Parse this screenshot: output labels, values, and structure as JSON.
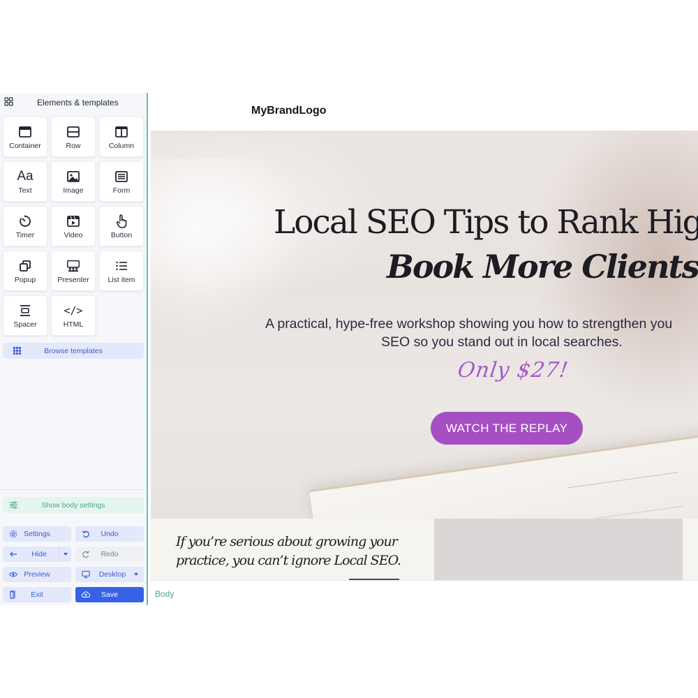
{
  "sidebar": {
    "title": "Elements & templates",
    "elements": [
      {
        "label": "Container",
        "icon": "container-icon"
      },
      {
        "label": "Row",
        "icon": "row-icon"
      },
      {
        "label": "Column",
        "icon": "column-icon"
      },
      {
        "label": "Text",
        "icon": "text-icon"
      },
      {
        "label": "Image",
        "icon": "image-icon"
      },
      {
        "label": "Form",
        "icon": "form-icon"
      },
      {
        "label": "Timer",
        "icon": "timer-icon"
      },
      {
        "label": "Video",
        "icon": "video-icon"
      },
      {
        "label": "Button",
        "icon": "pointer-icon"
      },
      {
        "label": "Popup",
        "icon": "popup-icon"
      },
      {
        "label": "Presenter",
        "icon": "presenter-icon"
      },
      {
        "label": "List item",
        "icon": "list-icon"
      },
      {
        "label": "Spacer",
        "icon": "spacer-icon"
      },
      {
        "label": "HTML",
        "icon": "code-icon"
      }
    ],
    "text_glyph": "Aa",
    "code_glyph": "</>",
    "browse_templates": "Browse templates",
    "show_body_settings": "Show body settings",
    "controls": {
      "settings": "Settings",
      "undo": "Undo",
      "hide": "Hide",
      "redo": "Redo",
      "preview": "Preview",
      "device": "Desktop",
      "exit": "Exit",
      "save": "Save"
    }
  },
  "canvas": {
    "brand_logo": "MyBrandLogo",
    "hero": {
      "title_line1": "Local SEO Tips to Rank Higher a",
      "title_line2": "Book More Clients",
      "subtitle_line1": "A practical, hype-free workshop showing you how to strengthen you",
      "subtitle_line2": "SEO so you stand out in local searches.",
      "price": "Only $27!",
      "cta": "WATCH THE REPLAY"
    },
    "lower": {
      "text_line1": "If you’re serious about growing your",
      "text_line2": "practice, you can’t ignore Local SEO."
    },
    "status_label": "Body"
  },
  "colors": {
    "accent_green": "#63c2a6",
    "primary_blue": "#3862e6",
    "cta_purple": "#a64fc2",
    "price_purple": "#a55ac8"
  }
}
